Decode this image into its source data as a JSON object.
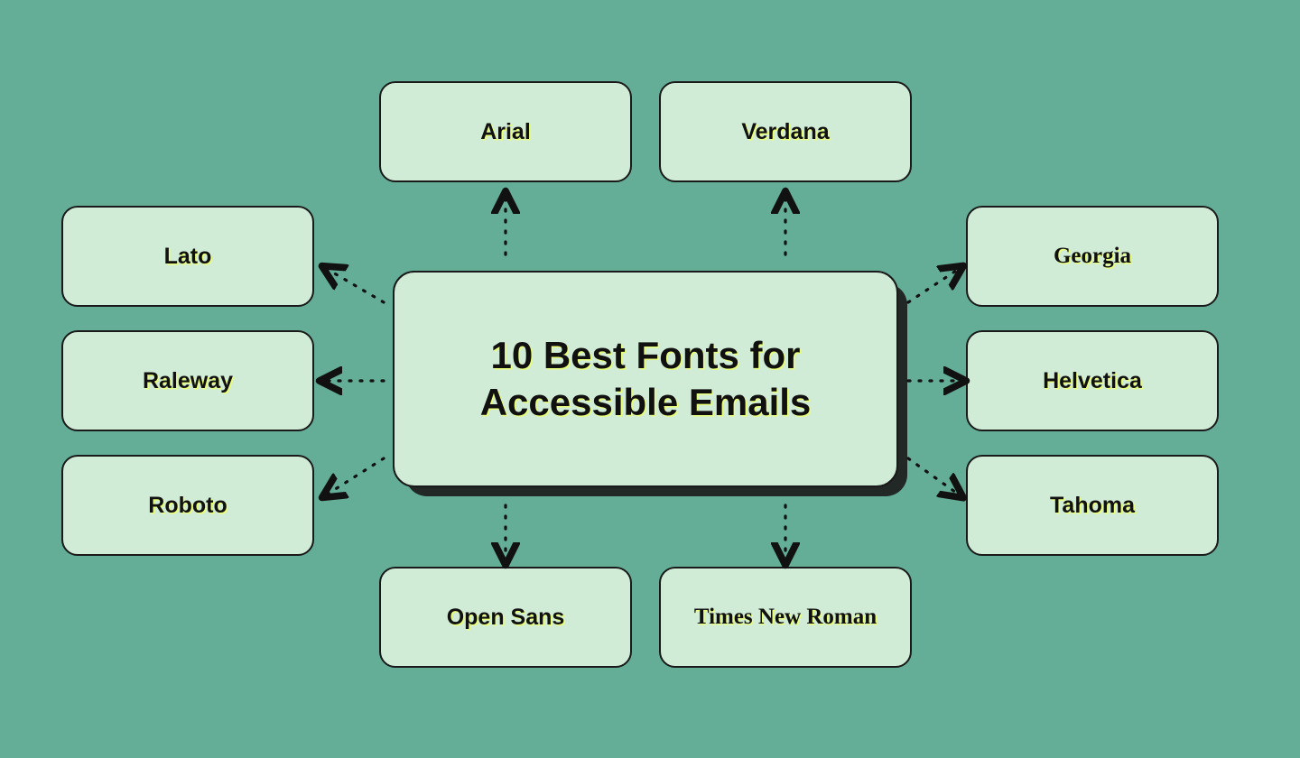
{
  "center": {
    "title": "10 Best Fonts for Accessible Emails"
  },
  "fonts": {
    "arial": "Arial",
    "verdana": "Verdana",
    "lato": "Lato",
    "raleway": "Raleway",
    "roboto": "Roboto",
    "georgia": "Georgia",
    "helvetica": "Helvetica",
    "tahoma": "Tahoma",
    "opensans": "Open Sans",
    "times": "Times New Roman"
  }
}
